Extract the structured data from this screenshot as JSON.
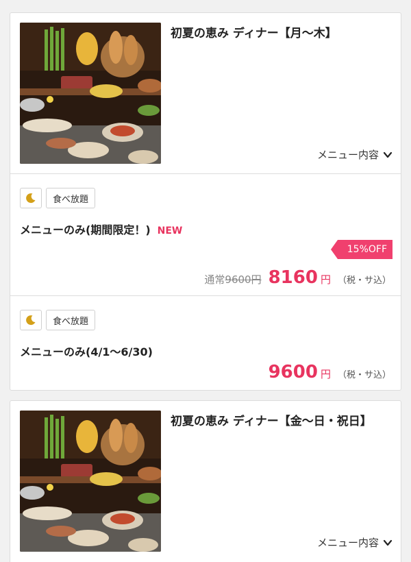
{
  "courses": [
    {
      "title": "初夏の恵み ディナー【月〜木】",
      "menu_toggle": "メニュー内容",
      "plans": [
        {
          "tag_icon": "moon-icon",
          "tag_label": "食べ放題",
          "name": "メニューのみ(期間限定！)",
          "new_label": "NEW",
          "discount": "15%OFF",
          "regular_prefix": "通常",
          "regular_price": "9600円",
          "price": "8160",
          "unit": "円",
          "tax": "（税・サ込）"
        },
        {
          "tag_icon": "moon-icon",
          "tag_label": "食べ放題",
          "name": "メニューのみ(4/1〜6/30)",
          "price": "9600",
          "unit": "円",
          "tax": "（税・サ込）"
        }
      ]
    },
    {
      "title": "初夏の恵み ディナー【金〜日・祝日】",
      "menu_toggle": "メニュー内容"
    }
  ],
  "colors": {
    "accent": "#e8345f",
    "discount_bg": "#f0406e",
    "moon": "#d4a019",
    "background": "#f1f1f1"
  }
}
